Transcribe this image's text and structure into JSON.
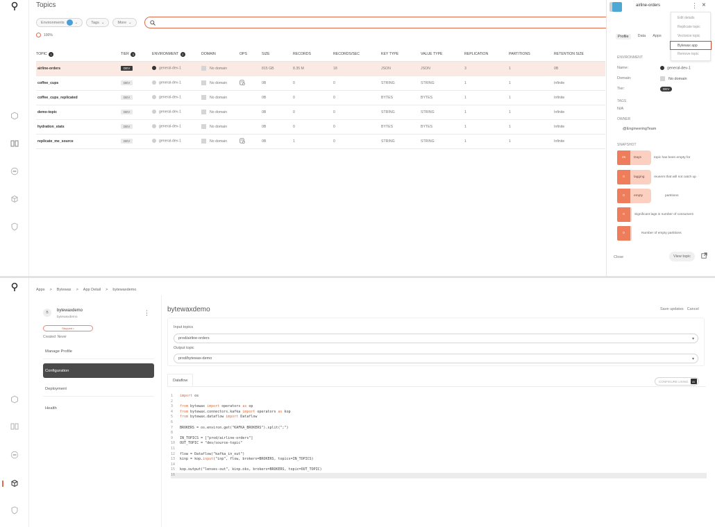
{
  "screen1": {
    "title": "Topics",
    "filters": [
      {
        "label": "Environments",
        "has_dot": true
      },
      {
        "label": "Tags",
        "has_dot": false
      },
      {
        "label": "More",
        "has_dot": false
      }
    ],
    "search_value": "",
    "progress_label": "100%",
    "columns": {
      "topic": "TOPIC",
      "topic_badge": "1",
      "tier": "TIER",
      "tier_badge": "3",
      "environment": "ENVIRONMENT",
      "environment_badge": "2",
      "domain": "DOMAIN",
      "ops": "OPS",
      "size": "SIZE",
      "records": "RECORDS",
      "records_sec": "RECORDS/SEC",
      "key_type": "KEY TYPE",
      "value_type": "VALUE TYPE",
      "replication": "REPLICATION",
      "partitions": "PARTITIONS",
      "retention": "RETENTION SIZE"
    },
    "rows": [
      {
        "name": "airline-orders",
        "tier": "DEV",
        "env": "general-dev-1",
        "domain": "No domain",
        "ops": false,
        "size": "815 GB",
        "records": "8.35 M",
        "rps": "18",
        "key": "JSON",
        "value": "JSON",
        "repl": "3",
        "parts": "1",
        "ret": "0B",
        "selected": true
      },
      {
        "name": "coffee_cups",
        "tier": "DEV",
        "env": "general-dev-1",
        "domain": "No domain",
        "ops": true,
        "size": "0B",
        "records": "0",
        "rps": "0",
        "key": "STRING",
        "value": "STRING",
        "repl": "1",
        "parts": "1",
        "ret": "Infinite",
        "selected": false
      },
      {
        "name": "coffee_cups_replicated",
        "tier": "DEV",
        "env": "general-dev-1",
        "domain": "No domain",
        "ops": false,
        "size": "0B",
        "records": "0",
        "rps": "0",
        "key": "BYTES",
        "value": "BYTES",
        "repl": "1",
        "parts": "1",
        "ret": "Infinite",
        "selected": false
      },
      {
        "name": "demo-topic",
        "tier": "DEV",
        "env": "general-dev-1",
        "domain": "No domain",
        "ops": false,
        "size": "0B",
        "records": "0",
        "rps": "0",
        "key": "STRING",
        "value": "STRING",
        "repl": "1",
        "parts": "1",
        "ret": "Infinite",
        "selected": false
      },
      {
        "name": "hydration_stats",
        "tier": "DEV",
        "env": "general-dev-1",
        "domain": "No domain",
        "ops": false,
        "size": "0B",
        "records": "0",
        "rps": "0",
        "key": "BYTES",
        "value": "BYTES",
        "repl": "1",
        "parts": "1",
        "ret": "Infinite",
        "selected": false
      },
      {
        "name": "replicate_me_source",
        "tier": "DEV",
        "env": "general-dev-1",
        "domain": "No domain",
        "ops": true,
        "size": "0B",
        "records": "1",
        "rps": "0",
        "key": "STRING",
        "value": "STRING",
        "repl": "1",
        "parts": "1",
        "ret": "Infinite",
        "selected": false
      }
    ],
    "side": {
      "title": "airline-orders",
      "tabs": [
        "Profile",
        "Data",
        "Apps"
      ],
      "menu": [
        "Edit details",
        "Replicate topic",
        "Vectorize topic",
        "Bytewax app",
        "Remove topic"
      ],
      "environment_heading": "ENVIRONMENT",
      "name_label": "Name:",
      "name_value": "general-dev-1",
      "domain_label": "Domain:",
      "domain_value": "No domain",
      "tier_label": "Tier:",
      "tier_value": "DEV",
      "tags_heading": "TAGS",
      "tags_value": "N/A",
      "owner_heading": "OWNER",
      "owner_value": "@EngineeringTeam",
      "snapshot_heading": "SNAPSHOT",
      "snapshot": [
        {
          "num": "25",
          "label": "Days",
          "desc": "topic has been empty for"
        },
        {
          "num": "0",
          "label": "lagging",
          "desc": "reusers that will not catch up"
        },
        {
          "num": "0",
          "label": "empty",
          "desc": "partitions"
        },
        {
          "num": "0",
          "label": "",
          "desc": "Significant lags in number of consumers"
        },
        {
          "num": "0",
          "label": "",
          "desc": "Number of empty partitions"
        }
      ],
      "close_label": "Close",
      "view_label": "View topic"
    }
  },
  "screen2": {
    "breadcrumbs": [
      "Apps",
      ">",
      "Bytewax",
      ">",
      "App Detail",
      ">",
      "bytewaxdemo"
    ],
    "app": {
      "initial": "B",
      "name": "bytewaxdemo",
      "sub": "bytewaxdemo",
      "status": "Stopped",
      "created": "Created: Never"
    },
    "nav": [
      "Manage Profile",
      "Configuration",
      "Deployment",
      "Health"
    ],
    "title": "bytewaxdemo",
    "save_label": "Save updates",
    "cancel_label": "Cancel",
    "input_label": "Input topics",
    "input_value": "prod/airline-orders",
    "output_label": "Output topic",
    "output_value": "prod/bytewax-demo",
    "dataflow_tab": "Dataflow",
    "configure_label": "CONFIGURE USING",
    "configure_badge": "AI",
    "code": [
      {
        "n": "1",
        "kw": "import",
        "rest": " os"
      },
      {
        "n": "2",
        "kw": "",
        "rest": ""
      },
      {
        "n": "3",
        "kw": "from",
        "rest": " bytewax ",
        "kw2": "import",
        "rest2": " operators ",
        "kw3": "as",
        "rest3": " op"
      },
      {
        "n": "4",
        "kw": "from",
        "rest": " bytewax.connectors.kafka ",
        "kw2": "import",
        "rest2": " operators ",
        "kw3": "as",
        "rest3": " kop"
      },
      {
        "n": "5",
        "kw": "from",
        "rest": " bytewax.dataflow ",
        "kw2": "import",
        "rest2": " Dataflow"
      },
      {
        "n": "6",
        "kw": "",
        "rest": ""
      },
      {
        "n": "7",
        "kw": "",
        "rest": "BROKERS = os.environ.get(\"KAFKA_BROKERS\").split(\";\")"
      },
      {
        "n": "8",
        "kw": "",
        "rest": ""
      },
      {
        "n": "9",
        "kw": "",
        "rest": "IN_TOPICS = [\"prod/airline-orders\"]"
      },
      {
        "n": "10",
        "kw": "",
        "rest": "OUT_TOPIC = \"dev/source-topic\""
      },
      {
        "n": "11",
        "kw": "",
        "rest": ""
      },
      {
        "n": "12",
        "kw": "",
        "rest": "flow = Dataflow(\"kafka_in_out\")"
      },
      {
        "n": "13",
        "kw": "",
        "rest": "kinp = kop.",
        "kw2": "input",
        "rest2": "(\"inp\", flow, brokers=BROKERS, topics=IN_TOPICS)"
      },
      {
        "n": "14",
        "kw": "",
        "rest": ""
      },
      {
        "n": "15",
        "kw": "",
        "rest": "kop.output(\"lenses-out\", kinp.oks, brokers=BROKERS, topic=OUT_TOPIC)"
      },
      {
        "n": "16",
        "kw": "",
        "rest": ""
      }
    ]
  },
  "colors": {
    "accent": "#e06a4b",
    "snapshot_num": "#ee7d5c",
    "snapshot_label": "#fbd0c0",
    "env_dot": "#4a9fd8"
  }
}
